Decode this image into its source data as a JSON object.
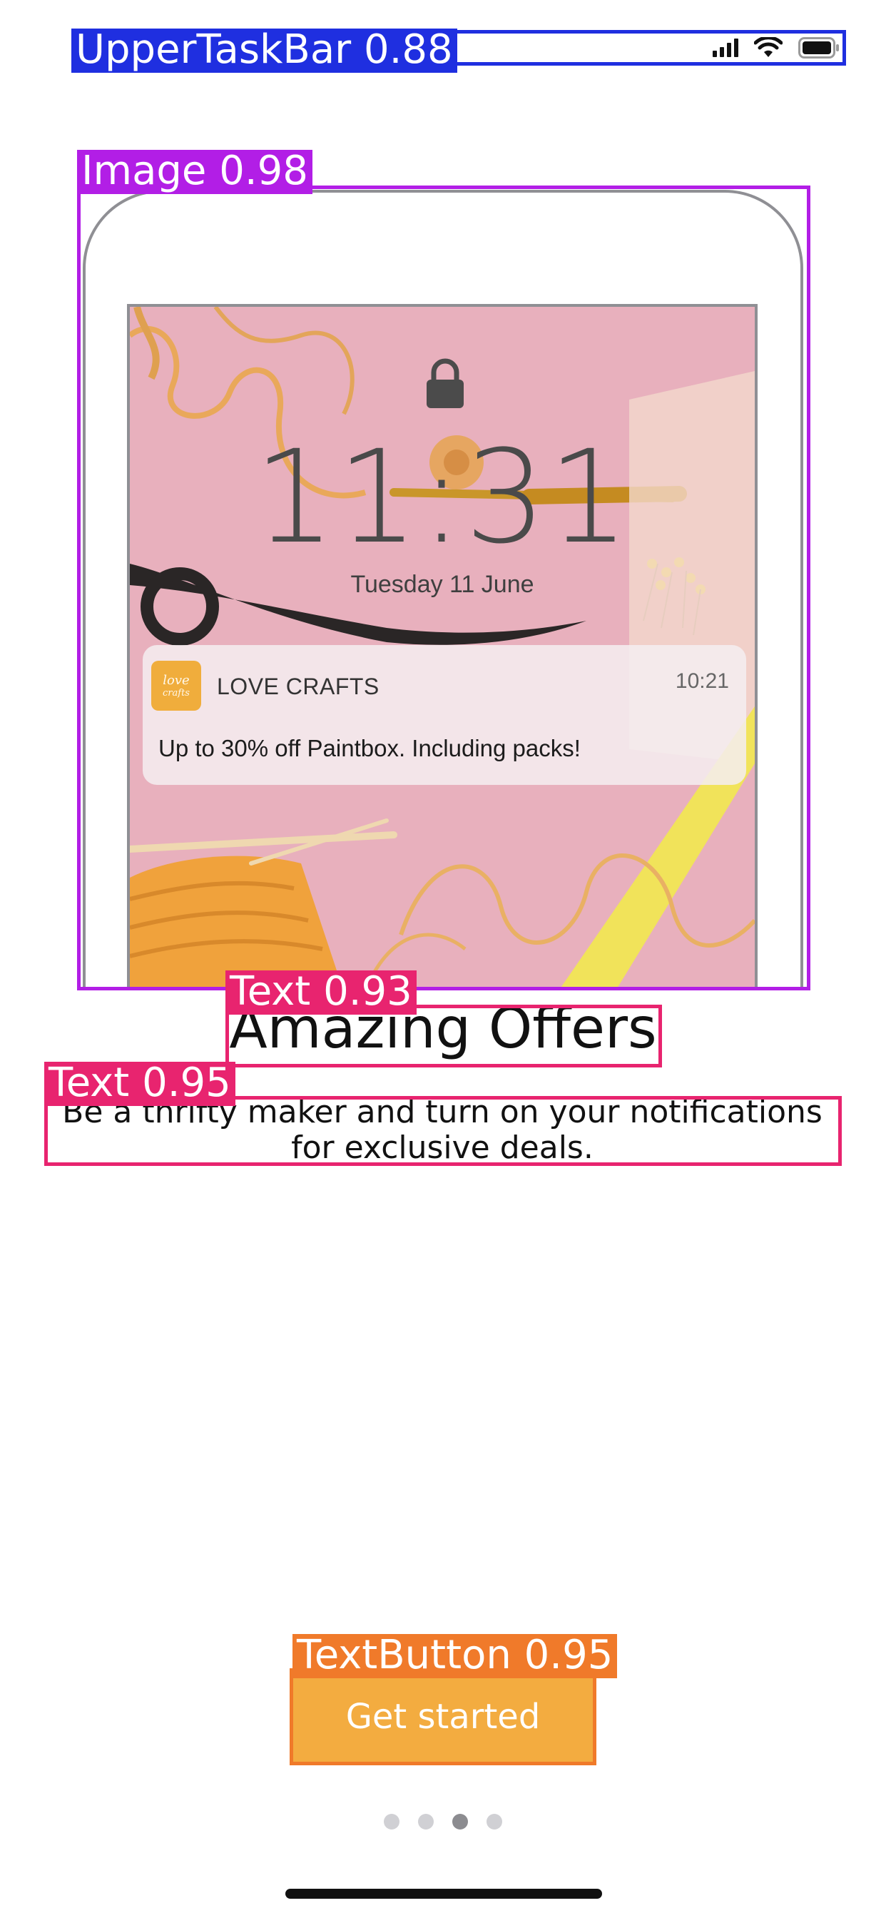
{
  "status_bar": {
    "icons": [
      "signal-icon",
      "wifi-icon",
      "battery-icon"
    ]
  },
  "promo": {
    "illustration": {
      "lock_screen_time": "11:31",
      "lock_screen_date": "Tuesday 11 June",
      "notification": {
        "logo_text_line1": "love",
        "logo_text_line2": "crafts",
        "app_name": "LOVE CRAFTS",
        "time": "10:21",
        "message": "Up to 30% off Paintbox. Including packs!"
      }
    },
    "title": "Amazing Offers",
    "description": "Be a thrifty maker and turn on your notifications for exclusive deals."
  },
  "cta": {
    "label": "Get started"
  },
  "pager": {
    "total": 4,
    "active_index": 3
  },
  "annotations": [
    {
      "label": "UpperTaskBar",
      "score": "0.88"
    },
    {
      "label": "Image",
      "score": "0.98"
    },
    {
      "label": "Text",
      "score": "0.93"
    },
    {
      "label": "Text",
      "score": "0.95"
    },
    {
      "label": "TextButton",
      "score": "0.95"
    }
  ],
  "colors": {
    "accent": "#f3ac40",
    "annotation_uppertaskbar": "#1f2fe0",
    "annotation_image": "#b21ee6",
    "annotation_text": "#e8246f",
    "annotation_textbutton": "#f07a2a"
  }
}
